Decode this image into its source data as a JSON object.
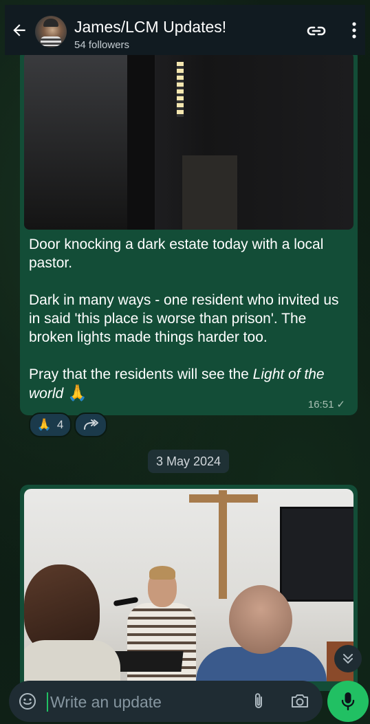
{
  "header": {
    "title": "James/LCM Updates!",
    "subtitle": "54 followers",
    "icons": [
      "back-arrow-icon",
      "link-icon",
      "more-vert-icon"
    ]
  },
  "messages": [
    {
      "text_p1": "Door knocking a dark estate today with a local pastor.",
      "text_p2": "Dark in many ways - one resident who invited us in said 'this place is worse than prison'. The broken lights made things harder too.",
      "text_p3_prefix": "Pray that the residents will see the ",
      "text_p3_italic": "Light of the world",
      "emoji": "🙏",
      "time": "16:51",
      "status": "✓",
      "reaction": {
        "emoji": "🙏",
        "count": "4"
      }
    }
  ],
  "date_divider": "3 May 2024",
  "composer": {
    "placeholder": "Write an update"
  },
  "colors": {
    "bubble": "#134d37",
    "accent": "#21c063",
    "header": "#111b21"
  }
}
